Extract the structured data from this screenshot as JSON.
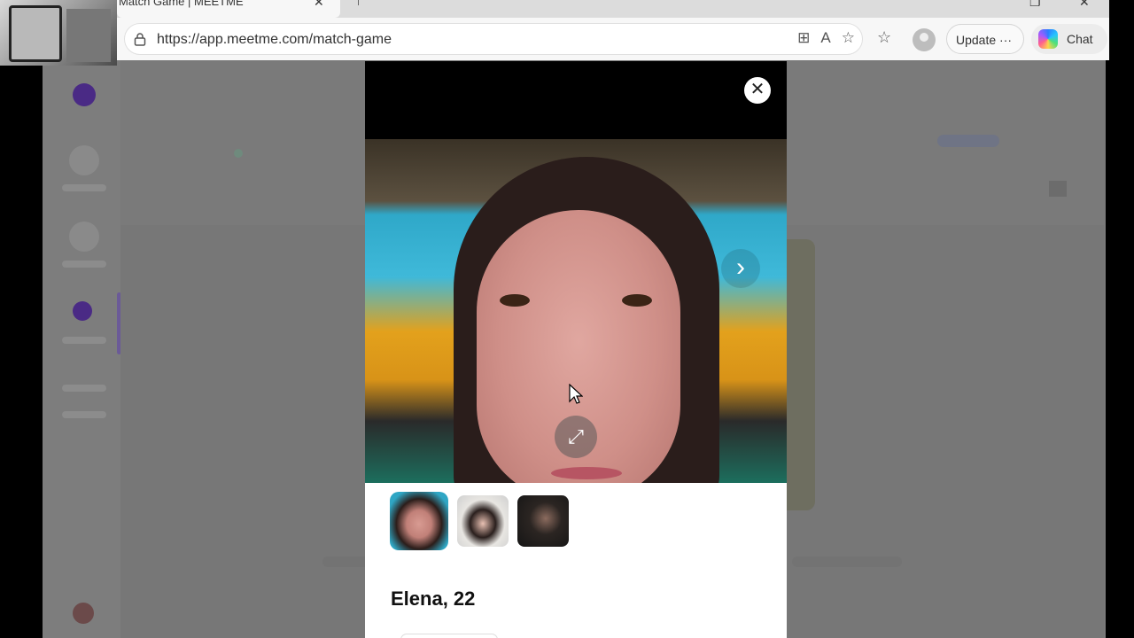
{
  "browser": {
    "tab_title": "Match Game | MEETME",
    "tab_close": "✕",
    "url": "https://app.meetme.com/match-game",
    "update_label": "Update",
    "update_more": "···",
    "chat_label": "Chat",
    "window_restore": "❐",
    "window_close": "✕"
  },
  "icons": {
    "lock": "lock-icon",
    "split_screen": "split-screen-icon",
    "read_aloud": "read-aloud-icon",
    "favorite": "star-icon",
    "favorites_list": "favorites-icon",
    "profile": "profile-icon",
    "copilot": "copilot-icon"
  },
  "modal": {
    "close_glyph": "✕",
    "next_glyph": "›",
    "expand_glyph": "⤢",
    "profile_name": "Elena, 22",
    "thumbnails": [
      {
        "label": "photo 1",
        "active": true
      },
      {
        "label": "photo 2",
        "active": false
      },
      {
        "label": "photo 3",
        "active": false
      }
    ]
  },
  "colors": {
    "brand_purple": "#4a2a85",
    "overlay_gray": "#7a7a7a"
  }
}
